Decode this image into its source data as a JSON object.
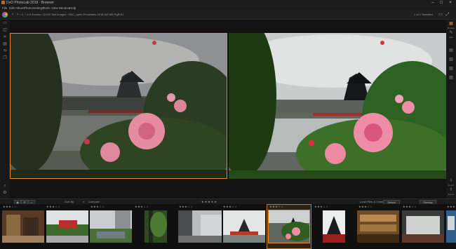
{
  "window": {
    "title": "DxO PhotoLab 2018 - Browser",
    "minimize": "–",
    "maximize": "□",
    "close": "×"
  },
  "menu": [
    "File",
    "Edit",
    "Album",
    "Photo",
    "Settings",
    "Tools",
    "View",
    "Window",
    "Help"
  ],
  "toolbar": {
    "breadcrumb": "› C: › 1-R Ecrans › DxO4 Test Images › SAC_open-Processes-2016-AE-W9-PgR-01",
    "selection_count": "1 of 1 Selected",
    "view_label": "1 Pane",
    "color_logo": "dxo-logo"
  },
  "sidebar_right": {
    "tabs": [
      {
        "label": "Browse",
        "icon": "browse-icon"
      },
      {
        "label": "Edit",
        "icon": "edit-icon"
      },
      {
        "label": "Presets",
        "icon": "presets-icon"
      },
      {
        "label": "Filters",
        "icon": "filters-icon"
      },
      {
        "label": "Histogram",
        "icon": "histogram-icon"
      },
      {
        "label": "Meta",
        "icon": "meta-icon"
      },
      {
        "label": "Import",
        "icon": "import-icon"
      },
      {
        "label": "Export",
        "icon": "export-icon"
      }
    ]
  },
  "filterbar": {
    "sort_label": "Sort By",
    "project_label": "Compare",
    "filter_label": "Load Files & Order",
    "filter_value": "Default",
    "search_label": "Search",
    "rating_stars": "★★★★★",
    "right_label": "Filmstrip"
  },
  "filmstrip": {
    "thumbs": [
      {
        "name": "market-street",
        "stars": "★★★☆☆"
      },
      {
        "name": "red-pagoda-garden",
        "stars": "★★★☆☆"
      },
      {
        "name": "tokyo-canal",
        "stars": "★★★☆☆"
      },
      {
        "name": "forest-path",
        "stars": "★★★☆☆"
      },
      {
        "name": "narrow-alley",
        "stars": "★★★☆☆"
      },
      {
        "name": "castle-lake",
        "stars": "★★★☆☆"
      },
      {
        "name": "castle-rose-selected",
        "stars": "★★★☆☆"
      },
      {
        "name": "castle-black",
        "stars": "★★★☆☆"
      },
      {
        "name": "bookshop-interior",
        "stars": "★★★☆☆"
      },
      {
        "name": "restaurant-interior",
        "stars": "★★★☆☆"
      },
      {
        "name": "blue-shop",
        "stars": "★★★☆☆"
      }
    ]
  }
}
